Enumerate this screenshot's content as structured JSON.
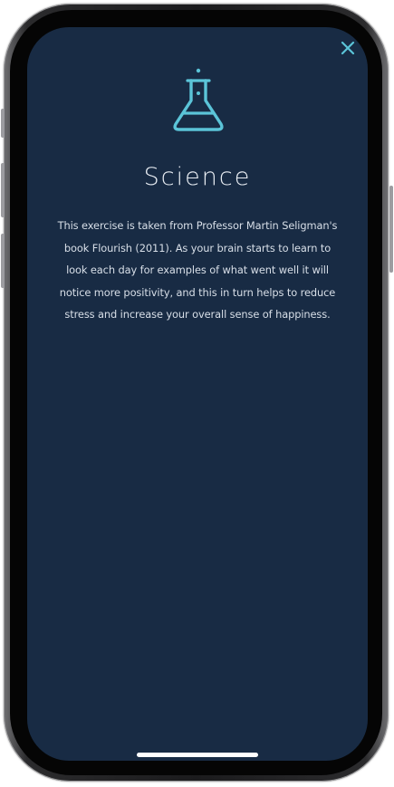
{
  "screen": {
    "title": "Science",
    "body": "This exercise is taken from Professor Martin Seligman's book Flourish (2011). As your brain starts to learn to look each day for examples of what went well it will notice more positivity, and this in turn helps to reduce stress and increase your overall sense of happiness.",
    "close_icon": "close-icon",
    "header_icon": "flask-icon"
  },
  "colors": {
    "background": "#182b44",
    "accent": "#5bc4d8",
    "text": "#d8dfe8"
  }
}
